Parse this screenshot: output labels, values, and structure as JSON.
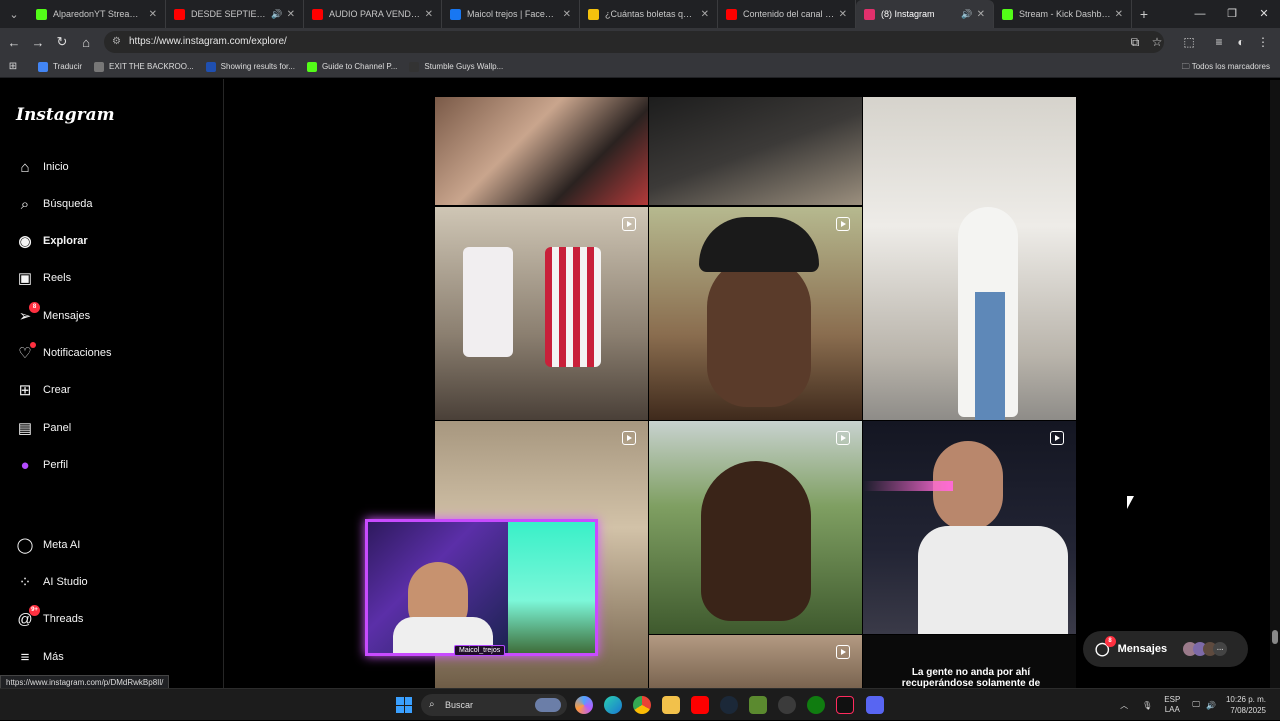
{
  "browser": {
    "tabs": [
      {
        "title": "AlparedonYT Stream - Wa",
        "color": "#53fc18"
      },
      {
        "title": "DESDE SEPTIEMBRE S",
        "color": "#ff0000",
        "audio": "🔊"
      },
      {
        "title": "AUDIO PARA VENDER MA",
        "color": "#ff0000"
      },
      {
        "title": "Maicol trejos | Facebook",
        "color": "#1877f2"
      },
      {
        "title": "¿Cuántas boletas quieres",
        "color": "#f4c20d"
      },
      {
        "title": "Contenido del canal - You",
        "color": "#ff0000"
      },
      {
        "title": "(8) Instagram",
        "color": "#e1306c",
        "active": true,
        "audio": "🔊"
      },
      {
        "title": "Stream - Kick Dashboard",
        "color": "#53fc18"
      }
    ],
    "url": "https://www.instagram.com/explore/",
    "bookmarks": [
      {
        "label": "Traducir",
        "color": "#4285f4"
      },
      {
        "label": "EXIT THE BACKROO...",
        "color": "#777777"
      },
      {
        "label": "Showing results for...",
        "color": "#1f4fb0"
      },
      {
        "label": "Guide to Channel P...",
        "color": "#53fc18"
      },
      {
        "label": "Stumble Guys Wallp...",
        "color": "#333333"
      }
    ],
    "all_bookmarks": "Todos los marcadores",
    "status_url": "https://www.instagram.com/p/DMdRwkBp8Il/"
  },
  "instagram": {
    "logo": "Instagram",
    "nav": [
      {
        "label": "Inicio",
        "icon": "home-icon"
      },
      {
        "label": "Búsqueda",
        "icon": "search-icon"
      },
      {
        "label": "Explorar",
        "icon": "compass-icon",
        "active": true
      },
      {
        "label": "Reels",
        "icon": "reels-icon"
      },
      {
        "label": "Mensajes",
        "icon": "messenger-icon",
        "badge": "8"
      },
      {
        "label": "Notificaciones",
        "icon": "heart-icon",
        "dot": true
      },
      {
        "label": "Crear",
        "icon": "plus-square-icon"
      },
      {
        "label": "Panel",
        "icon": "chart-icon"
      },
      {
        "label": "Perfil",
        "icon": "avatar-icon"
      },
      {
        "label": "Meta AI",
        "icon": "meta-ai-icon"
      },
      {
        "label": "AI Studio",
        "icon": "ai-studio-icon"
      },
      {
        "label": "Threads",
        "icon": "threads-icon",
        "badge": "9+"
      },
      {
        "label": "Más",
        "icon": "menu-icon"
      }
    ],
    "messages_pill": {
      "label": "Mensajes",
      "badge": "8"
    },
    "caption": "La gente no anda por ahí recuperándose solamente de",
    "webcam_name": "Maicol_trejos"
  },
  "taskbar": {
    "search": "Buscar",
    "lang": "ESP",
    "lang2": "LAA",
    "time": "10:26 p. m.",
    "date": "7/08/2025"
  }
}
